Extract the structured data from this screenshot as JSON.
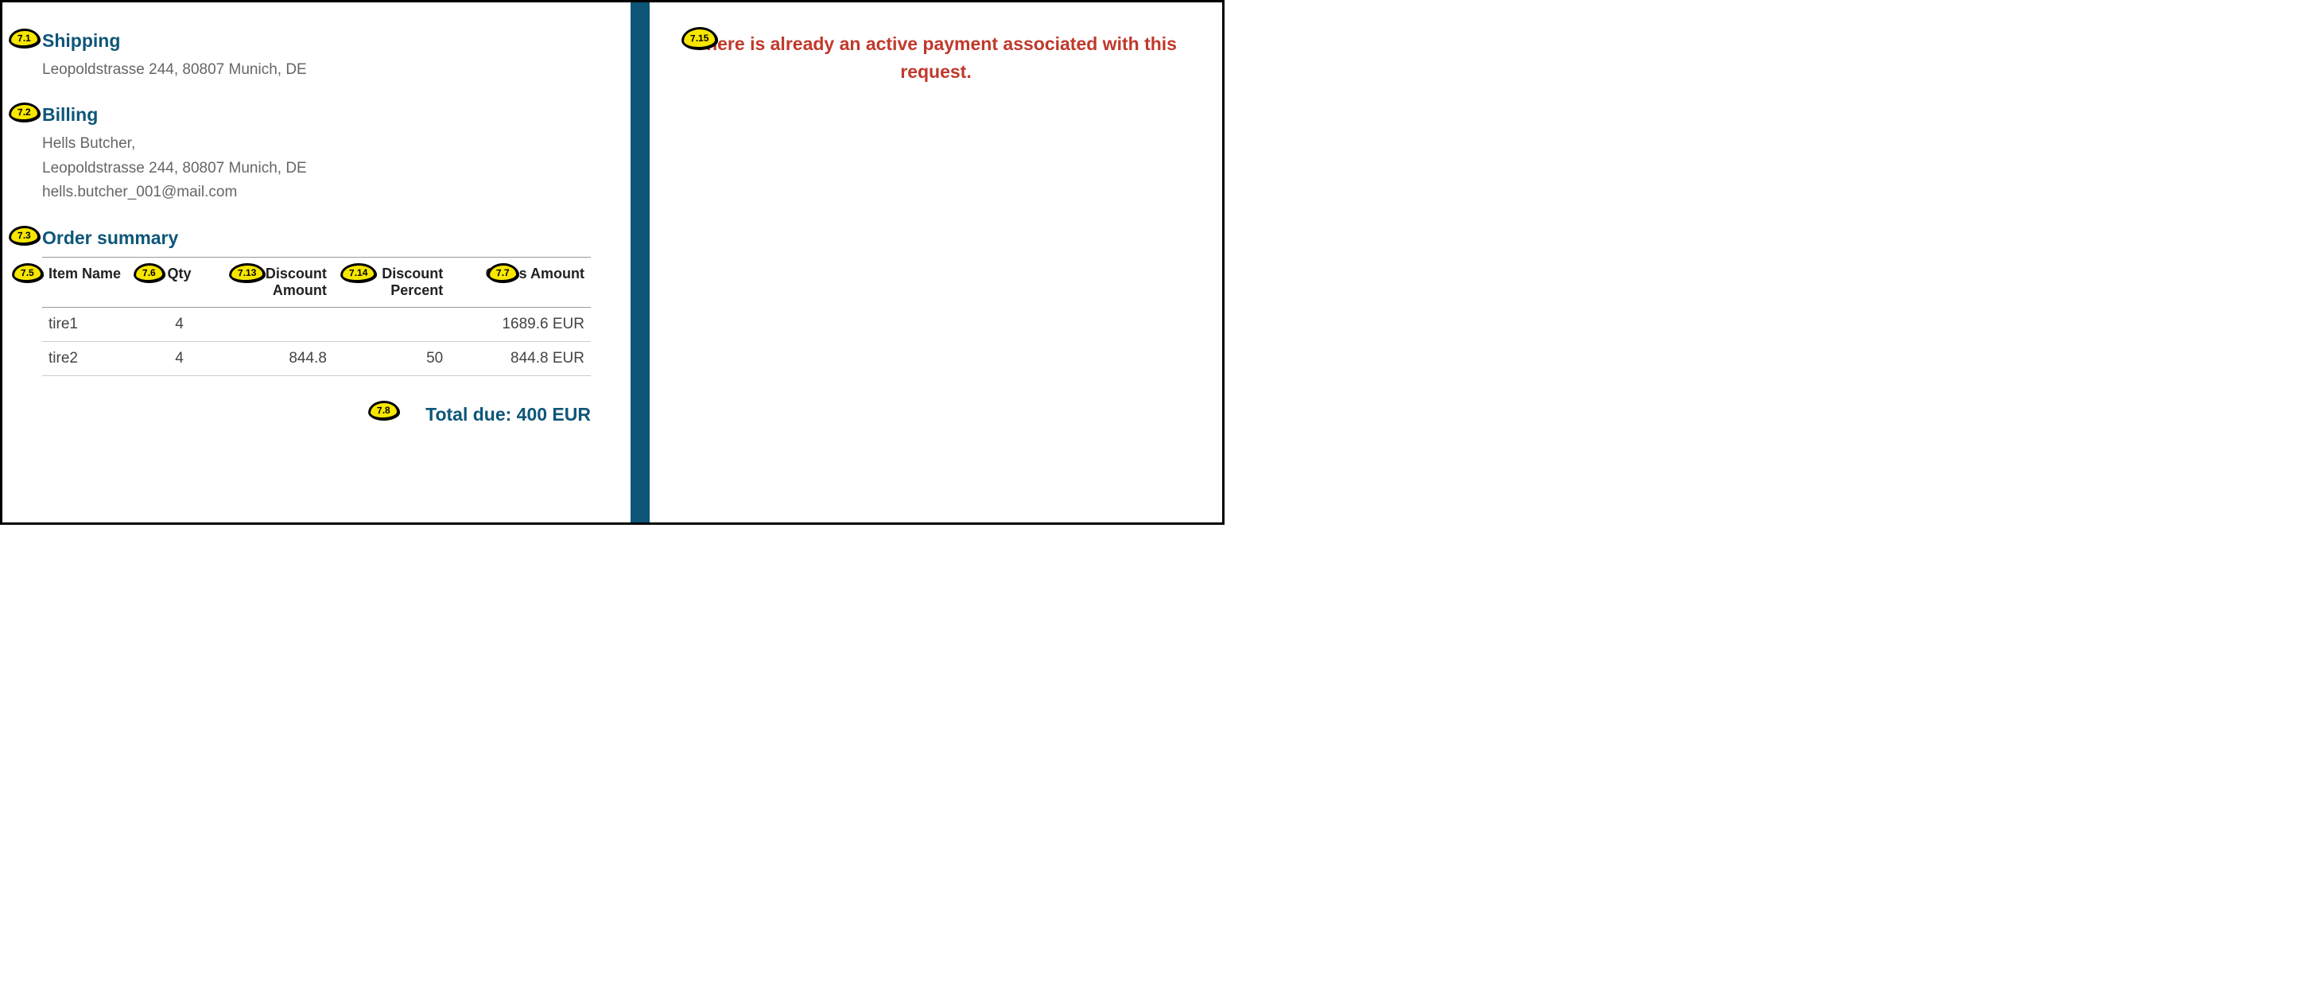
{
  "markers": {
    "m7_1": "7.1",
    "m7_2": "7.2",
    "m7_3": "7.3",
    "m7_5": "7.5",
    "m7_6": "7.6",
    "m7_7": "7.7",
    "m7_8": "7.8",
    "m7_13": "7.13",
    "m7_14": "7.14",
    "m7_15": "7.15"
  },
  "shipping": {
    "heading": "Shipping",
    "address": "Leopoldstrasse 244, 80807 Munich, DE"
  },
  "billing": {
    "heading": "Billing",
    "name": "Hells Butcher,",
    "address": "Leopoldstrasse 244, 80807 Munich, DE",
    "email": "hells.butcher_001@mail.com"
  },
  "order": {
    "heading": "Order summary",
    "columns": {
      "item_name": "Item Name",
      "qty": "Qty",
      "discount_amount": "Discount Amount",
      "discount_percent": "Discount Percent",
      "gross_amount": "Gross Amount"
    },
    "rows": [
      {
        "item_name": "tire1",
        "qty": "4",
        "discount_amount": "",
        "discount_percent": "",
        "gross_amount": "1689.6 EUR"
      },
      {
        "item_name": "tire2",
        "qty": "4",
        "discount_amount": "844.8",
        "discount_percent": "50",
        "gross_amount": "844.8 EUR"
      }
    ],
    "total_due": "Total due: 400 EUR"
  },
  "error": {
    "message": "There is already an active payment associated with this request."
  }
}
